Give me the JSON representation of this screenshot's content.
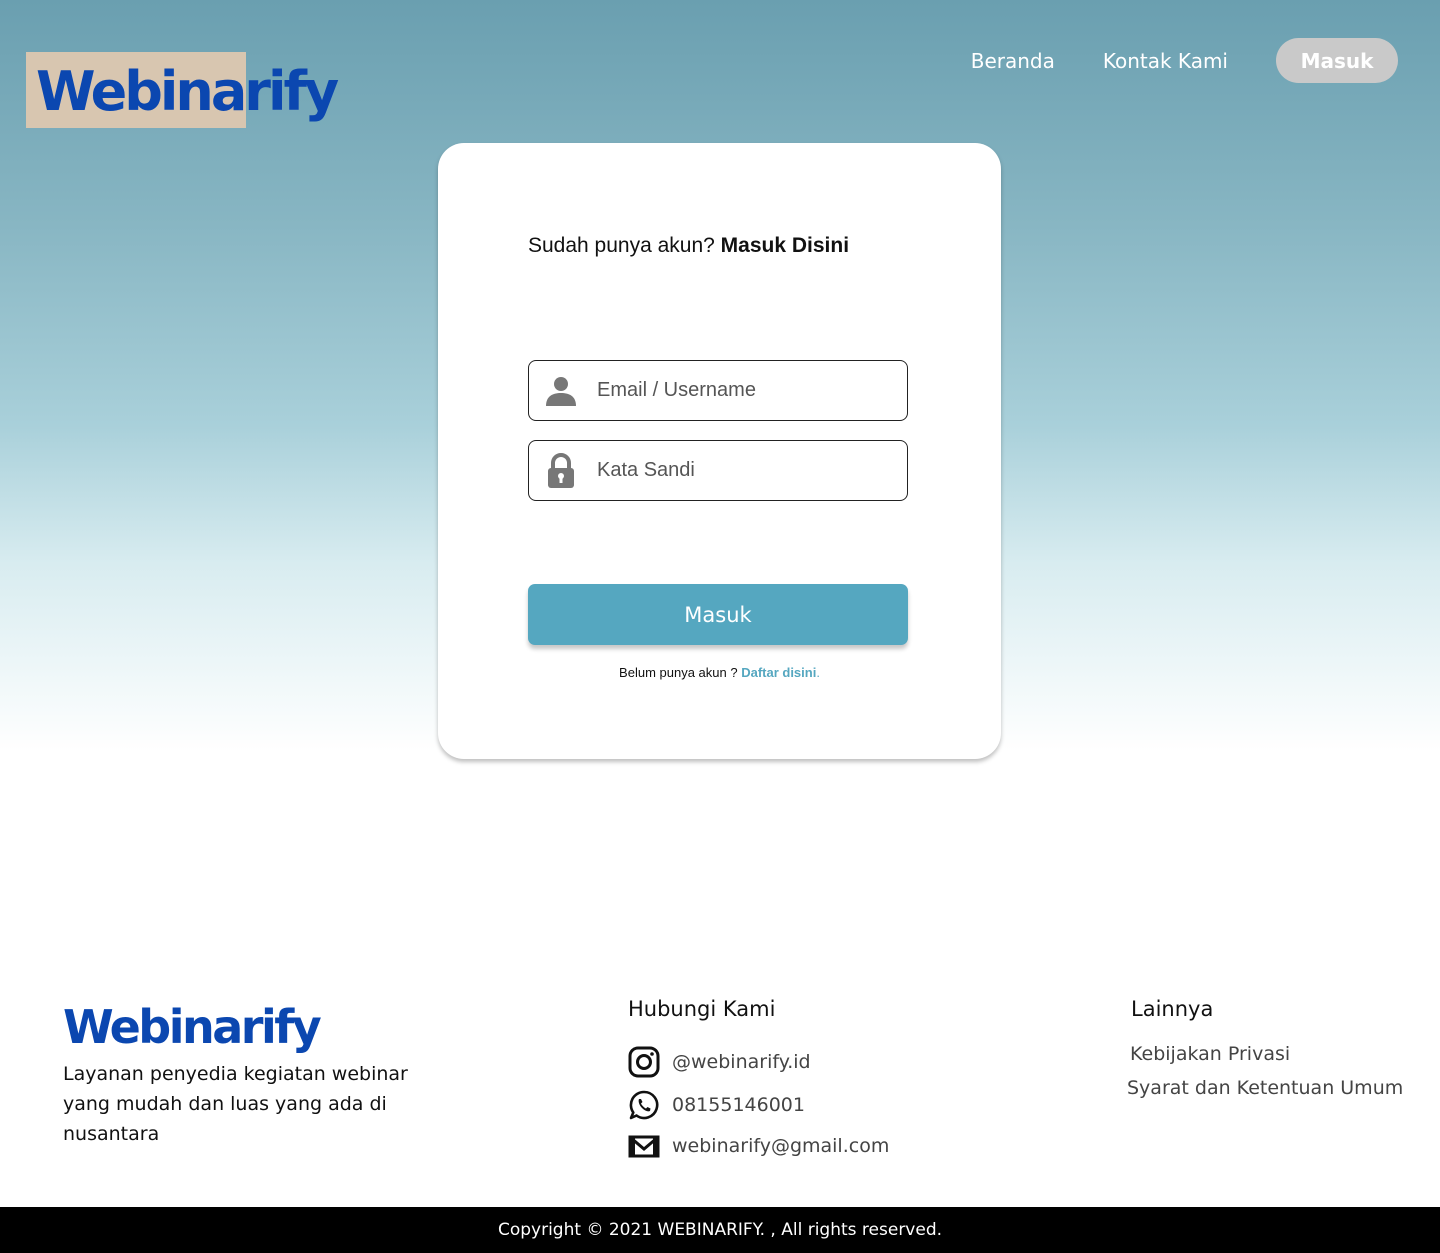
{
  "header": {
    "logo_text": "Webinarify",
    "nav": [
      {
        "label": "Beranda"
      },
      {
        "label": "Kontak Kami"
      }
    ],
    "login_button": "Masuk"
  },
  "login_card": {
    "heading_prefix": "Sudah punya akun?",
    "heading_bold": "Masuk Disini",
    "username_placeholder": "Email / Username",
    "password_placeholder": "Kata Sandi",
    "submit_label": "Masuk",
    "register_prompt": "Belum punya akun ?",
    "register_link": "Daftar disini",
    "register_suffix": "."
  },
  "footer": {
    "logo_text": "Webinarify",
    "tagline": "Layanan penyedia kegiatan webinar yang mudah dan luas yang ada di nusantara",
    "contact_heading": "Hubungi Kami",
    "contacts": [
      {
        "icon": "instagram-icon",
        "text": "@webinarify.id"
      },
      {
        "icon": "whatsapp-icon",
        "text": "08155146001"
      },
      {
        "icon": "mail-icon",
        "text": "webinarify@gmail.com"
      }
    ],
    "other_heading": "Lainnya",
    "other_links": [
      {
        "label": "Kebijakan Privasi"
      },
      {
        "label": "Syarat dan Ketentuan Umum"
      }
    ],
    "copyright": "Copyright © 2021 WEBINARIFY. , All rights reserved."
  },
  "colors": {
    "brand_blue": "#0b47b0",
    "accent": "#55a7c0",
    "logo_patch": "#d8c6b0"
  }
}
